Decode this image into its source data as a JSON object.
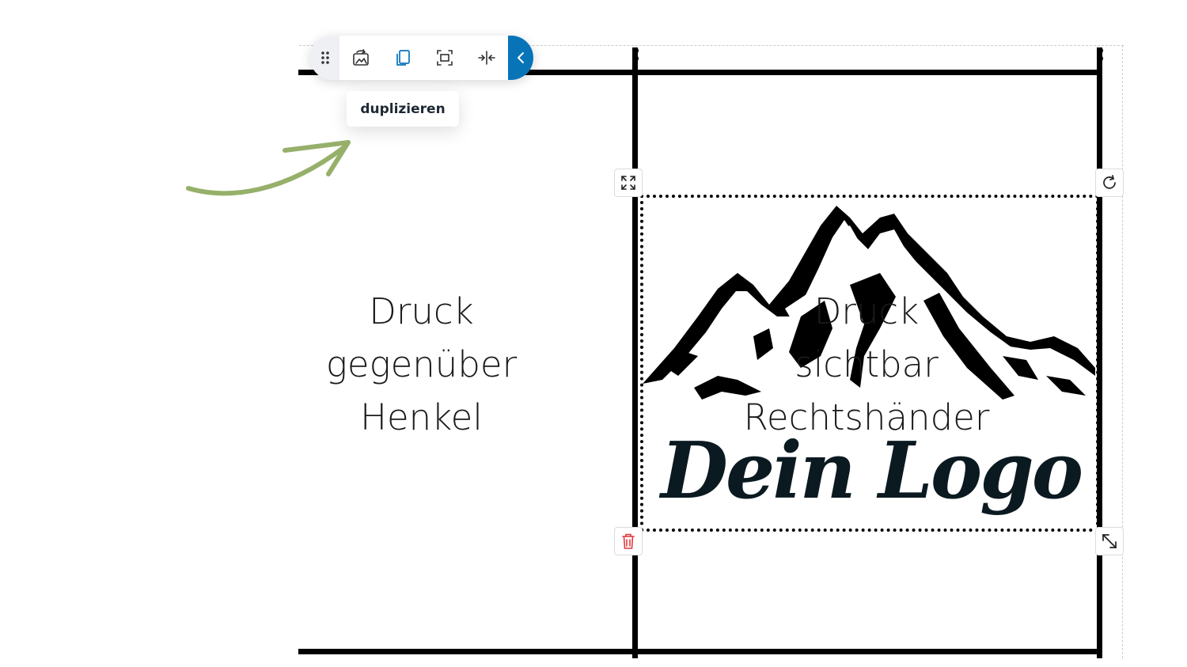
{
  "toolbar": {
    "buttons": [
      {
        "name": "drag-handle",
        "icon": "grip-dots-icon"
      },
      {
        "name": "replace-image",
        "icon": "image-refresh-icon"
      },
      {
        "name": "duplicate",
        "icon": "copy-icon",
        "active": true,
        "color": "#0874b8"
      },
      {
        "name": "fit-to-area",
        "icon": "fit-frame-icon"
      },
      {
        "name": "center",
        "icon": "center-align-icon"
      },
      {
        "name": "collapse",
        "icon": "chevron-left-icon",
        "color": "#0874b8"
      }
    ],
    "tooltip": "duplizieren"
  },
  "canvas": {
    "zone_left_lines": [
      "Druck",
      "gegenüber",
      "Henkel"
    ],
    "zone_right_lines": [
      "Druck",
      "sichtbar",
      "Rechtshänder"
    ]
  },
  "selected_element": {
    "logo_text": "Dein Logo",
    "handles": {
      "expand": "expand-icon",
      "rotate": "rotate-icon",
      "delete": "trash-icon",
      "resize": "resize-icon"
    },
    "delete_color": "#e0383e"
  },
  "annotation": {
    "arrow_color": "#96b06a"
  }
}
